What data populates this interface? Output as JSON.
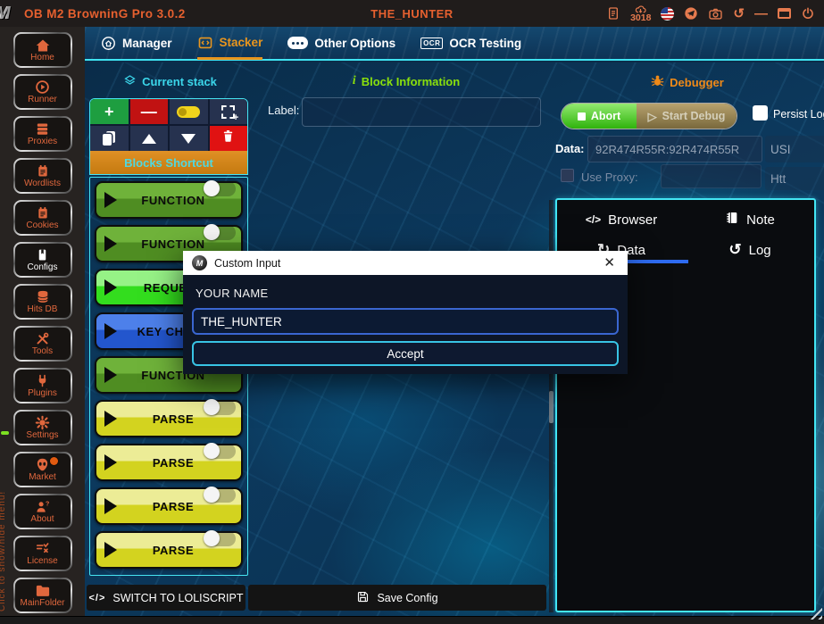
{
  "titlebar": {
    "app_title": "OB M2 BrowninG Pro  3.0.2",
    "user_title": "THE_HUNTER",
    "downloads": "3018"
  },
  "tabs": [
    {
      "label": "Manager"
    },
    {
      "label": "Stacker"
    },
    {
      "label": "Other Options"
    },
    {
      "label": "OCR Testing"
    }
  ],
  "sidebar": {
    "items": [
      {
        "label": "Home"
      },
      {
        "label": "Runner"
      },
      {
        "label": "Proxies"
      },
      {
        "label": "Wordlists"
      },
      {
        "label": "Cookies"
      },
      {
        "label": "Configs"
      },
      {
        "label": "Hits DB"
      },
      {
        "label": "Tools"
      },
      {
        "label": "Plugins"
      },
      {
        "label": "Settings"
      },
      {
        "label": "Market"
      },
      {
        "label": "About"
      },
      {
        "label": "License"
      },
      {
        "label": "MainFolder"
      }
    ],
    "edge_note": "Click to show/hide menu!"
  },
  "stack": {
    "header": "Current stack",
    "shortcut_label": "Blocks Shortcut",
    "blocks": [
      {
        "label": "FUNCTION",
        "type": "function"
      },
      {
        "label": "FUNCTION",
        "type": "function"
      },
      {
        "label": "REQUEST",
        "type": "request"
      },
      {
        "label": "KEY CHECK",
        "type": "keycheck"
      },
      {
        "label": "FUNCTION",
        "type": "function"
      },
      {
        "label": "PARSE",
        "type": "parse"
      },
      {
        "label": "PARSE",
        "type": "parse"
      },
      {
        "label": "PARSE",
        "type": "parse"
      },
      {
        "label": "PARSE",
        "type": "parse"
      }
    ],
    "switch_label": "SWITCH TO LOLISCRIPT",
    "save_label": "Save Config"
  },
  "block_info": {
    "header": "Block Information",
    "label_caption": "Label:",
    "label_value": ""
  },
  "debugger": {
    "header": "Debugger",
    "abort_label": "Abort",
    "start_label": "Start Debug",
    "persist_label": "Persist Log",
    "data_caption": "Data:",
    "data_value": "92R474R55R:92R474R55R",
    "wordlist_type": "USI",
    "use_proxy_label": "Use Proxy:",
    "proxy_type": "Htt",
    "proxy_value": "",
    "tabs": [
      {
        "label": "Browser"
      },
      {
        "label": "Note"
      },
      {
        "label": "Data"
      },
      {
        "label": "Log"
      }
    ]
  },
  "modal": {
    "title": "Custom Input",
    "field_label": "YOUR NAME",
    "field_value": "THE_HUNTER",
    "accept_label": "Accept"
  },
  "icons": {
    "plus": "+",
    "minus": "—",
    "up": "▲",
    "down": "▼",
    "code": "</>",
    "refresh": "↻",
    "history": "↺",
    "close": "✕",
    "minimize": "—",
    "info": "i",
    "ghost_play": "▷",
    "logo": "M"
  },
  "colors": {
    "accent_orange": "#e6602f",
    "icon_orange": "#e0714a",
    "cyan": "#43e6f4",
    "header_green": "#8ae00c",
    "debug_orange": "#f08a18",
    "abort_green": "#3fb815",
    "modal_blue": "#3a66d0",
    "accept_cyan": "#38c4e4"
  }
}
